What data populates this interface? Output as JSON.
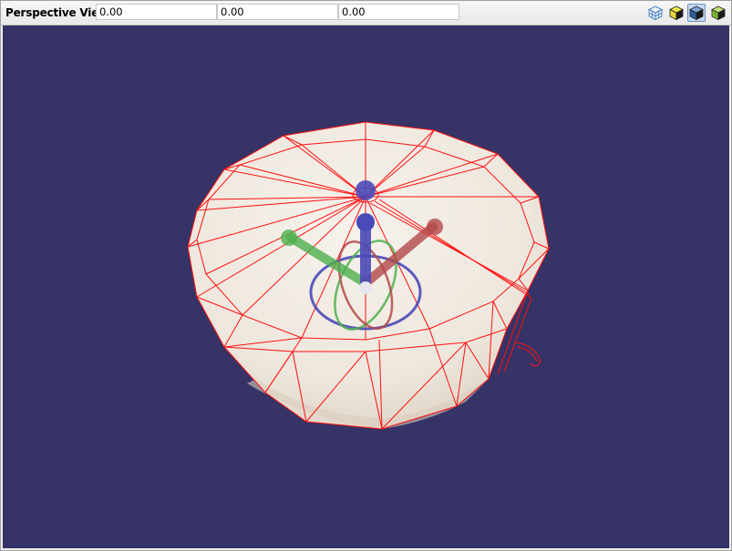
{
  "toolbar": {
    "view_title": "Perspective View",
    "x_value": "0.00",
    "y_value": "0.00",
    "z_value": "0.00",
    "buttons": [
      {
        "icon": "wireframe-cube-icon",
        "active": false
      },
      {
        "icon": "solid-cube-icon",
        "active": false
      },
      {
        "icon": "shaded-cube-icon",
        "active": true
      },
      {
        "icon": "textured-cube-icon",
        "active": false
      }
    ]
  },
  "viewport": {
    "background_color": "#363366",
    "mesh_fill_color": "#f1ebe3",
    "wireframe_color": "#ff0000",
    "gizmo_colors": {
      "x": "#b34a4a",
      "y": "#4fb04f",
      "z": "#4a4ab8"
    }
  }
}
